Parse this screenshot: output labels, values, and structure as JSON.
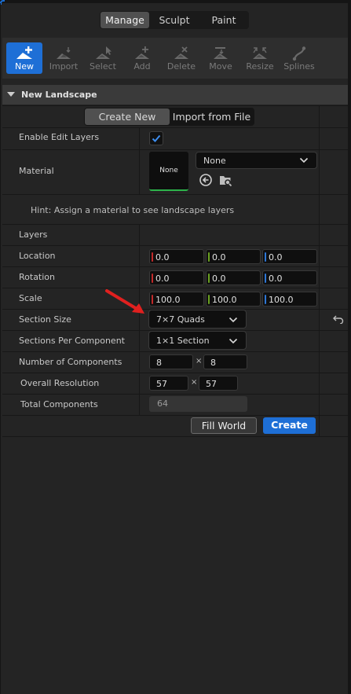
{
  "mode_tabs": {
    "manage": "Manage",
    "sculpt": "Sculpt",
    "paint": "Paint",
    "active": "Manage"
  },
  "toolbar": {
    "new": "New",
    "import": "Import",
    "select": "Select",
    "add": "Add",
    "delete": "Delete",
    "move": "Move",
    "resize": "Resize",
    "splines": "Splines",
    "active": "New"
  },
  "section": {
    "title": "New Landscape"
  },
  "create_mode": {
    "create_new": "Create New",
    "import_from_file": "Import from File",
    "active": "Create New"
  },
  "fields": {
    "enable_edit_layers": {
      "label": "Enable Edit Layers",
      "checked": true
    },
    "material": {
      "label": "Material",
      "thumbnail_text": "None",
      "selected": "None"
    },
    "hint": "Hint: Assign a material to see landscape layers",
    "layers": {
      "label": "Layers"
    },
    "location": {
      "label": "Location",
      "x": "0.0",
      "y": "0.0",
      "z": "0.0"
    },
    "rotation": {
      "label": "Rotation",
      "x": "0.0",
      "y": "0.0",
      "z": "0.0"
    },
    "scale": {
      "label": "Scale",
      "x": "100.0",
      "y": "100.0",
      "z": "100.0"
    },
    "section_size": {
      "label": "Section Size",
      "value": "7×7 Quads"
    },
    "sections_per_component": {
      "label": "Sections Per Component",
      "value": "1×1 Section"
    },
    "number_of_components": {
      "label": "Number of Components",
      "x": "8",
      "times": "×",
      "y": "8"
    },
    "overall_resolution": {
      "label": "Overall Resolution",
      "x": "57",
      "times": "×",
      "y": "57"
    },
    "total_components": {
      "label": "Total Components",
      "value": "64"
    }
  },
  "actions": {
    "fill_world": "Fill World",
    "create": "Create"
  },
  "colors": {
    "accent": "#1e6fd6",
    "axis_x": "#c22a2a",
    "axis_y": "#6aa121",
    "axis_z": "#2d77d6",
    "annotation": "#e0201f"
  }
}
